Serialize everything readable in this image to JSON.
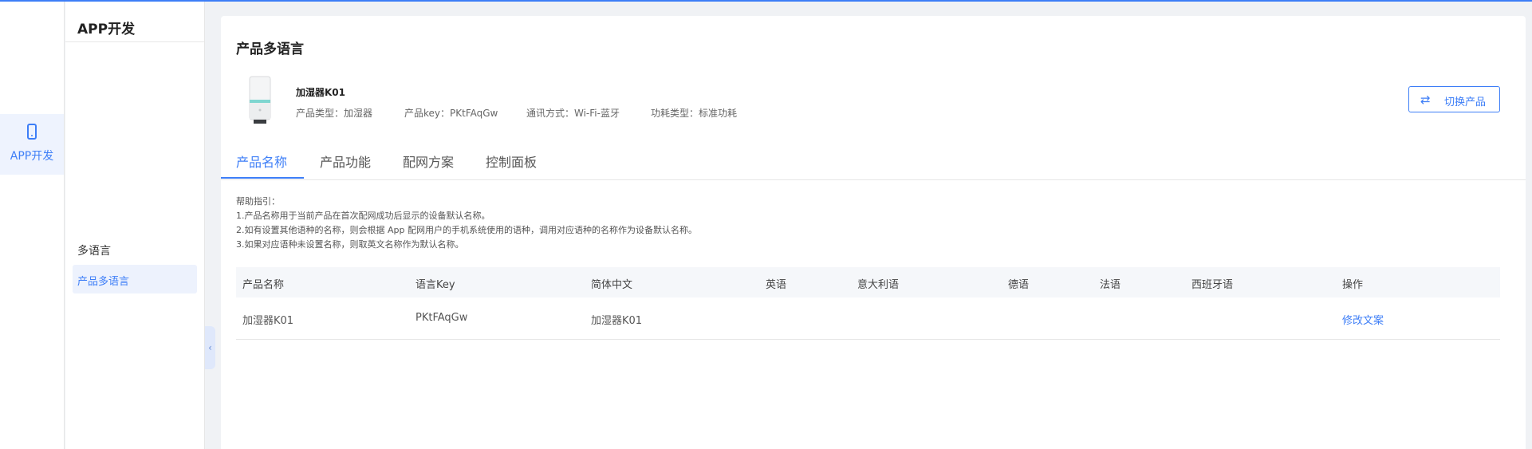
{
  "rail": {
    "app_dev_label": "APP开发"
  },
  "menu": {
    "title": "APP开发",
    "group_label": "多语言",
    "active_item": "产品多语言"
  },
  "page": {
    "title": "产品多语言",
    "product": {
      "name": "加湿器K01",
      "type": "产品类型：加湿器",
      "key": "产品key：PKtFAqGw",
      "comm": "通讯方式：Wi-Fi-蓝牙",
      "power": "功耗类型：标准功耗"
    },
    "switch_button": "切换产品",
    "tabs": [
      "产品名称",
      "产品功能",
      "配网方案",
      "控制面板"
    ],
    "help": [
      "帮助指引：",
      "1.产品名称用于当前产品在首次配网成功后显示的设备默认名称。",
      "2.如有设置其他语种的名称，则会根据 App 配网用户的手机系统使用的语种，调用对应语种的名称作为设备默认名称。",
      "3.如果对应语种未设置名称，则取英文名称作为默认名称。"
    ],
    "table": {
      "headers": [
        "产品名称",
        "语言Key",
        "简体中文",
        "英语",
        "意大利语",
        "德语",
        "法语",
        "西班牙语",
        "操作"
      ],
      "rows": [
        [
          "加湿器K01",
          "PKtFAqGw",
          "加湿器K01",
          "",
          "",
          "",
          "",
          "",
          "修改文案"
        ]
      ]
    }
  },
  "colors": {
    "accent": "#3d7ef7",
    "background": "#f0f2f5"
  }
}
